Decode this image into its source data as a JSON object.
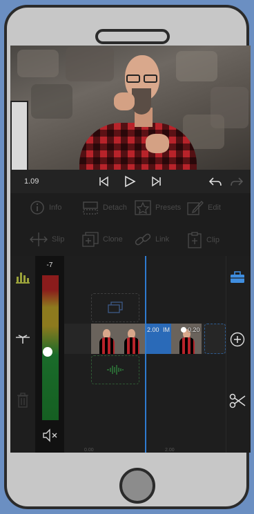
{
  "transport": {
    "timecode": "1.09"
  },
  "tools": [
    {
      "label": "Info",
      "icon": "info-icon"
    },
    {
      "label": "Detach",
      "icon": "detach-icon"
    },
    {
      "label": "Presets",
      "icon": "star-icon"
    },
    {
      "label": "Edit",
      "icon": "pencil-icon"
    },
    {
      "label": "Slip",
      "icon": "slip-icon"
    },
    {
      "label": "Clone",
      "icon": "clone-icon"
    },
    {
      "label": "Link",
      "icon": "link-icon"
    },
    {
      "label": "Clip",
      "icon": "clip-icon"
    }
  ],
  "timeline": {
    "meter_value": "-7",
    "volume_level": 0.47,
    "ruler": [
      "0.00",
      "2.00"
    ],
    "clip_a_label": "2.00",
    "clip_a_suffix": "IM",
    "clip_b_label": "0.20"
  },
  "colors": {
    "accent": "#2e7bd0",
    "meter_green": "#1a6b2a",
    "meter_red": "#8a1c1c",
    "tool_disabled": "#4a4a4a"
  }
}
